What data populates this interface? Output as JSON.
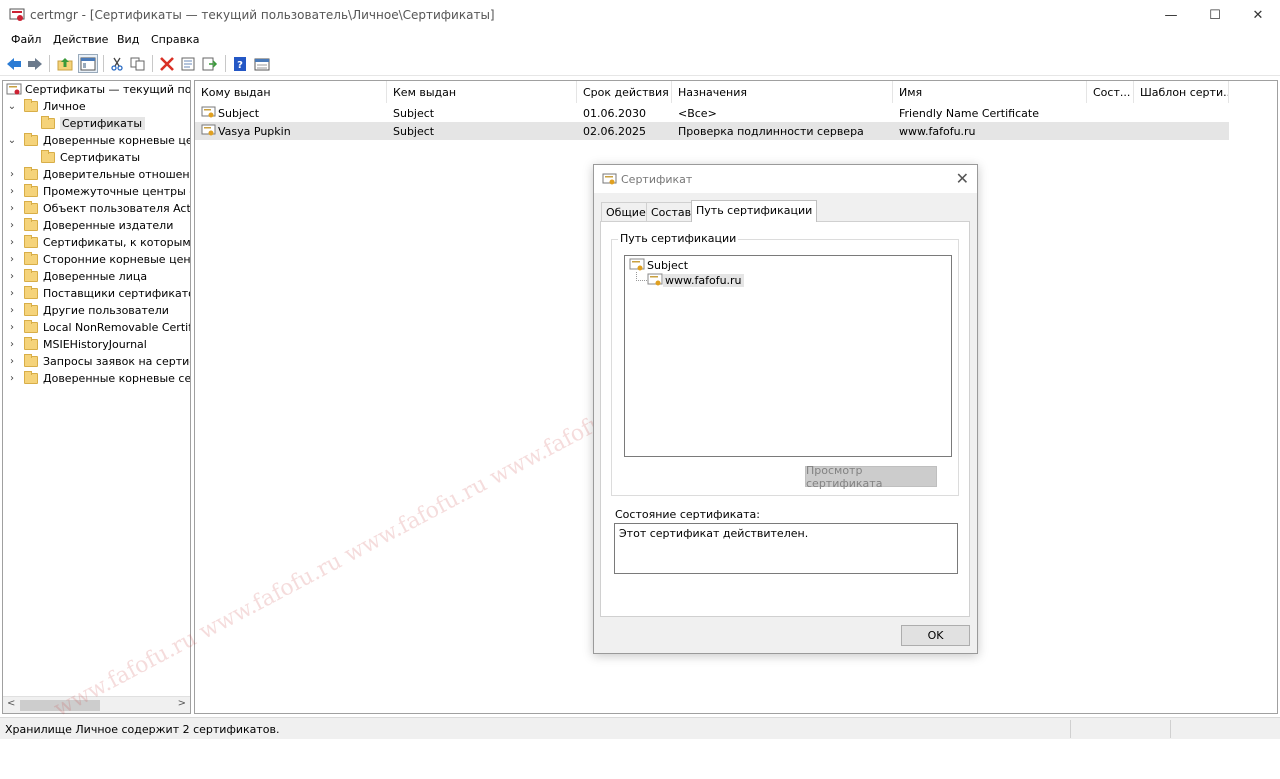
{
  "window": {
    "title": "certmgr - [Сертификаты — текущий пользователь\\Личное\\Сертификаты]"
  },
  "menu": [
    "Файл",
    "Действие",
    "Вид",
    "Справка"
  ],
  "toolbar_icons": [
    "back-arrow-icon",
    "forward-arrow-icon",
    "up-folder-icon",
    "show-hide-tree-icon",
    "cut-icon",
    "copy-icon",
    "delete-icon",
    "properties-icon",
    "export-icon",
    "help-icon",
    "view-icon"
  ],
  "tree": {
    "root": "Сертификаты — текущий пользо",
    "items": [
      {
        "label": "Личное",
        "level": 1,
        "expand": "v"
      },
      {
        "label": "Сертификаты",
        "level": 2,
        "expand": "",
        "selected": true
      },
      {
        "label": "Доверенные корневые центры",
        "level": 1,
        "expand": "v"
      },
      {
        "label": "Сертификаты",
        "level": 2,
        "expand": ""
      },
      {
        "label": "Доверительные отношения",
        "level": 1,
        "expand": ">"
      },
      {
        "label": "Промежуточные центры сертиф",
        "level": 1,
        "expand": ">"
      },
      {
        "label": "Объект пользователя Active Dir",
        "level": 1,
        "expand": ">"
      },
      {
        "label": "Доверенные издатели",
        "level": 1,
        "expand": ">"
      },
      {
        "label": "Сертификаты, к которым нет до",
        "level": 1,
        "expand": ">"
      },
      {
        "label": "Сторонние корневые центры",
        "level": 1,
        "expand": ">"
      },
      {
        "label": "Доверенные лица",
        "level": 1,
        "expand": ">"
      },
      {
        "label": "Поставщики сертификатов",
        "level": 1,
        "expand": ">"
      },
      {
        "label": "Другие пользователи",
        "level": 1,
        "expand": ">"
      },
      {
        "label": "Local NonRemovable Certificates",
        "level": 1,
        "expand": ">"
      },
      {
        "label": "MSIEHistoryJournal",
        "level": 1,
        "expand": ">"
      },
      {
        "label": "Запросы заявок на сертифика",
        "level": 1,
        "expand": ">"
      },
      {
        "label": "Доверенные корневые сертиф",
        "level": 1,
        "expand": ">"
      }
    ]
  },
  "list": {
    "columns": [
      "Кому выдан",
      "Кем выдан",
      "Срок действия",
      "Назначения",
      "Имя",
      "Сост...",
      "Шаблон серти..."
    ],
    "rows": [
      {
        "issued_to": "Subject",
        "issued_by": "Subject",
        "expires": "01.06.2030",
        "purposes": "<Все>",
        "name": "Friendly Name Certificate",
        "status": "",
        "template": "",
        "selected": false
      },
      {
        "issued_to": "Vasya Pupkin",
        "issued_by": "Subject",
        "expires": "02.06.2025",
        "purposes": "Проверка подлинности сервера",
        "name": "www.fafofu.ru",
        "status": "",
        "template": "",
        "selected": true
      }
    ]
  },
  "status_bar": {
    "text": "Хранилище Личное содержит 2 сертификатов."
  },
  "dialog": {
    "title": "Сертификат",
    "tabs": [
      "Общие",
      "Состав",
      "Путь сертификации"
    ],
    "active_tab": 2,
    "group_label": "Путь сертификации",
    "path_nodes": [
      "Subject",
      "www.fafofu.ru"
    ],
    "view_cert_button": "Просмотр сертификата",
    "status_label": "Состояние сертификата:",
    "status_text": "Этот сертификат действителен.",
    "ok_button": "OK"
  },
  "watermark": "www.fafofu.ru www.fafofu.ru www.fafofu.ru www.fafofu.ru www.fafofu.ru www.fafofu.ru",
  "colors": {
    "selection": "#e5e5e5",
    "folder": "#f5d37a",
    "delete": "#d93025",
    "help": "#2457c5"
  }
}
